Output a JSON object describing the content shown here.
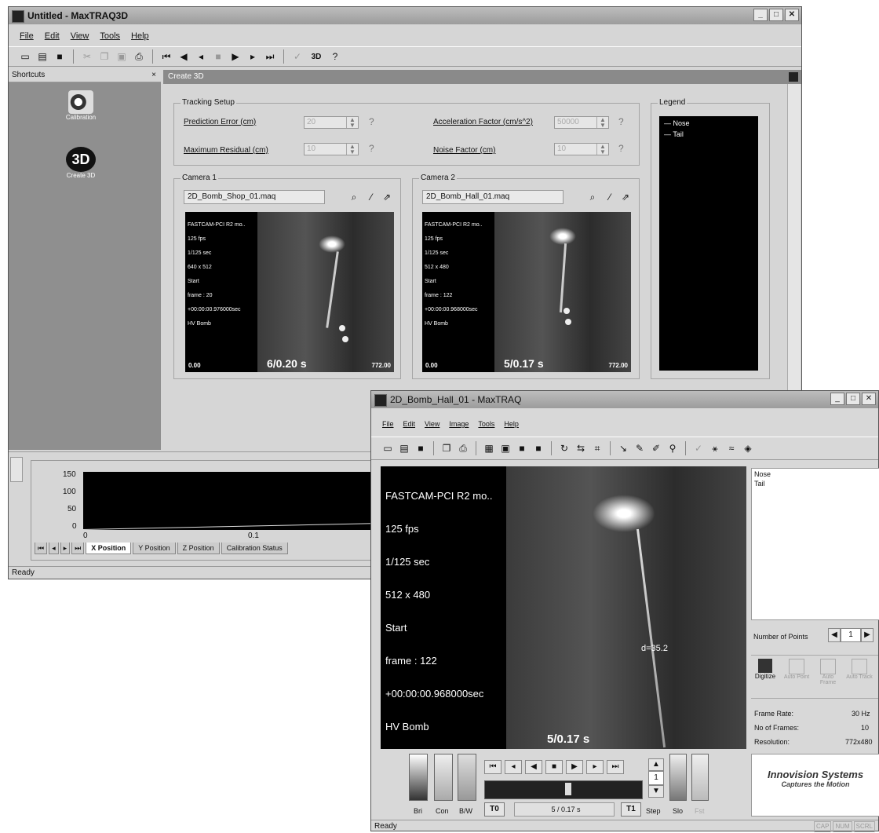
{
  "main_window": {
    "title": "Untitled - MaxTRAQ3D",
    "menu": [
      "File",
      "Edit",
      "View",
      "Tools",
      "Help"
    ],
    "toolbar_3d_label": "3D",
    "shortcuts": {
      "title": "Shortcuts",
      "close": "×",
      "items": [
        {
          "label": "Calibration",
          "icon": "calibration-icon"
        },
        {
          "label": "Create 3D",
          "icon": "create-3d-icon"
        }
      ]
    },
    "panel_title": "Create 3D",
    "tracking_setup": {
      "title": "Tracking Setup",
      "prediction_error_label": "Prediction Error (cm)",
      "prediction_error_value": "20",
      "max_residual_label": "Maximum Residual (cm)",
      "max_residual_value": "10",
      "accel_factor_label": "Acceleration Factor (cm/s^2)",
      "accel_factor_value": "50000",
      "noise_factor_label": "Noise Factor (cm)",
      "noise_factor_value": "10"
    },
    "legend": {
      "title": "Legend",
      "items": [
        "Nose",
        "Tail"
      ]
    },
    "camera1": {
      "title": "Camera 1",
      "file": "2D_Bomb_Shop_01.maq",
      "overlay": [
        "FASTCAM-PCI R2 mo..",
        "125 fps",
        "1/125 sec",
        "640 x 512",
        "Start",
        "frame : 20",
        "+00:00:00.976000sec",
        "HV Bomb"
      ],
      "frame_caption": "6/0.20 s",
      "left_time": "0.00",
      "right_time": "772.00"
    },
    "camera2": {
      "title": "Camera 2",
      "file": "2D_Bomb_Hall_01.maq",
      "overlay": [
        "FASTCAM-PCI R2 mo..",
        "125 fps",
        "1/125 sec",
        "512 x 480",
        "Start",
        "frame : 122",
        "+00:00:00.968000sec",
        "HV Bomb"
      ],
      "frame_caption": "5/0.17 s",
      "left_time": "0.00",
      "right_time": "772.00"
    },
    "graph": {
      "y_ticks": [
        "150",
        "100",
        "50",
        "0"
      ],
      "x_ticks": [
        "0",
        "0.1"
      ],
      "tabs": [
        "X Position",
        "Y Position",
        "Z Position",
        "Calibration Status"
      ],
      "active_tab": "X Position"
    },
    "status": "Ready"
  },
  "sub_window": {
    "title": "2D_Bomb_Hall_01 - MaxTRAQ",
    "menu": [
      "File",
      "Edit",
      "View",
      "Image",
      "Tools",
      "Help"
    ],
    "overlay": [
      "FASTCAM-PCI R2 mo..",
      "125 fps",
      "1/125 sec",
      "512 x 480",
      "Start",
      "frame : 122",
      "+00:00:00.968000sec",
      "HV Bomb"
    ],
    "point_label": "d=35.2",
    "frame_caption": "5/0.17 s",
    "points_list": [
      "Nose",
      "Tail"
    ],
    "number_of_points_label": "Number of Points",
    "number_of_points_value": "1",
    "digitize_buttons": [
      "Digitize",
      "Auto Point",
      "Auto Frame",
      "Auto Track"
    ],
    "frame_rate_label": "Frame Rate:",
    "frame_rate_value": "30 Hz",
    "frames_label": "No of Frames:",
    "frames_value": "10",
    "resolution_label": "Resolution:",
    "resolution_value": "772x480",
    "brand_name": "Innovision Systems",
    "brand_tagline": "Captures the Motion",
    "slider_labels": [
      "Bri",
      "Con",
      "B/W"
    ],
    "t0_label": "T0",
    "t1_label": "T1",
    "frame_field": "5 / 0.17 s",
    "step_value": "1",
    "step_label": "Step",
    "slo_label": "Slo",
    "fst_label": "Fst",
    "status": "Ready",
    "status_indicators": [
      "CAP",
      "NUM",
      "SCRL"
    ]
  }
}
